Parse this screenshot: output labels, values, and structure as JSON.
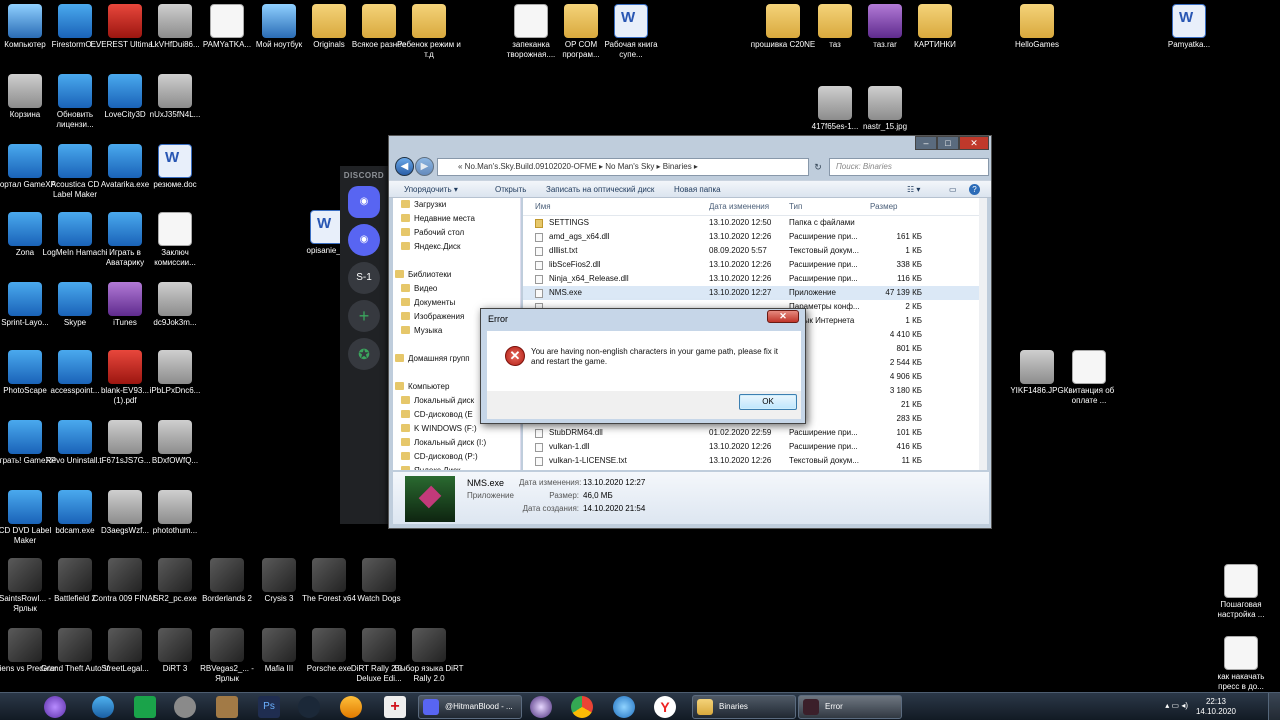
{
  "desktop": {
    "icons": [
      {
        "label": "Компьютер",
        "icon": "computer-icon"
      },
      {
        "label": "FirestormO...",
        "icon": "app-icon"
      },
      {
        "label": "EVEREST Ultima...",
        "icon": "info-icon"
      },
      {
        "label": "LkVHfDui86...",
        "icon": "image-icon"
      },
      {
        "label": "PAMYaTKA...",
        "icon": "document-icon"
      },
      {
        "label": "Мой ноутбук",
        "icon": "computer-icon"
      },
      {
        "label": "Originals",
        "icon": "folder-icon"
      },
      {
        "label": "Всякое разное",
        "icon": "folder-icon"
      },
      {
        "label": "Ребенок режим и т.д",
        "icon": "folder-icon"
      },
      {
        "label": "запеканка творожная....",
        "icon": "document-icon"
      },
      {
        "label": "OP COM програм...",
        "icon": "folder-icon"
      },
      {
        "label": "Рабочая книга супе...",
        "icon": "word-icon"
      },
      {
        "label": "прошивка C20NE",
        "icon": "folder-icon"
      },
      {
        "label": "таз",
        "icon": "folder-icon"
      },
      {
        "label": "таз.rar",
        "icon": "archive-icon"
      },
      {
        "label": "КАРТИНКИ",
        "icon": "folder-icon"
      },
      {
        "label": "HelloGames",
        "icon": "folder-icon"
      },
      {
        "label": "Pamyatka...",
        "icon": "word-icon"
      },
      {
        "label": "Корзина",
        "icon": "recycle-bin-icon"
      },
      {
        "label": "Обновить лицензи...",
        "icon": "app-icon"
      },
      {
        "label": "LoveCity3D",
        "icon": "app-icon"
      },
      {
        "label": "nUxJ35fN4L...",
        "icon": "image-icon"
      },
      {
        "label": "417f65es-1...",
        "icon": "image-icon"
      },
      {
        "label": "nastr_15.jpg",
        "icon": "image-icon"
      },
      {
        "label": "Портал GameXP",
        "icon": "app-icon"
      },
      {
        "label": "Acoustica CD Label Maker",
        "icon": "app-icon"
      },
      {
        "label": "Avatarika.exe",
        "icon": "app-icon"
      },
      {
        "label": "резюме.doc",
        "icon": "word-icon"
      },
      {
        "label": "opisanie_...",
        "icon": "word-icon"
      },
      {
        "label": "Zona",
        "icon": "app-icon"
      },
      {
        "label": "LogMeIn Hamachi",
        "icon": "app-icon"
      },
      {
        "label": "Играть в Аватарику",
        "icon": "app-icon"
      },
      {
        "label": "Заключ комиссии...",
        "icon": "document-icon"
      },
      {
        "label": "Sprint-Layo...",
        "icon": "app-icon"
      },
      {
        "label": "Skype",
        "icon": "skype-icon"
      },
      {
        "label": "iTunes",
        "icon": "itunes-icon"
      },
      {
        "label": "dc9Jok3m...",
        "icon": "image-icon"
      },
      {
        "label": "PhotoScape",
        "icon": "app-icon"
      },
      {
        "label": "accesspoint...",
        "icon": "app-icon"
      },
      {
        "label": "blank-EV93... (1).pdf",
        "icon": "pdf-icon"
      },
      {
        "label": "iPbLPxDnc6...",
        "icon": "image-icon"
      },
      {
        "label": "YIKF1486.JPG",
        "icon": "image-icon"
      },
      {
        "label": "Квитанция об оплате ...",
        "icon": "document-icon"
      },
      {
        "label": "Играть! GameXP",
        "icon": "app-icon"
      },
      {
        "label": "Revo Uninstall...",
        "icon": "app-icon"
      },
      {
        "label": "tF671sJS7G...",
        "icon": "image-icon"
      },
      {
        "label": "BDxfOWfQ...",
        "icon": "image-icon"
      },
      {
        "label": "CD DVD Label Maker",
        "icon": "app-icon"
      },
      {
        "label": "bdcam.exe",
        "icon": "app-icon"
      },
      {
        "label": "D3aegsWzf...",
        "icon": "image-icon"
      },
      {
        "label": "photothum...",
        "icon": "image-icon"
      },
      {
        "label": "SaintsRowI... - Ярлык",
        "icon": "game-icon"
      },
      {
        "label": "Battlefield 2",
        "icon": "game-icon"
      },
      {
        "label": "Contra 009 FINAL",
        "icon": "game-icon"
      },
      {
        "label": "SR2_pc.exe",
        "icon": "game-icon"
      },
      {
        "label": "Borderlands 2",
        "icon": "game-icon"
      },
      {
        "label": "Crysis 3",
        "icon": "game-icon"
      },
      {
        "label": "The Forest x64",
        "icon": "game-icon"
      },
      {
        "label": "Watch Dogs",
        "icon": "game-icon"
      },
      {
        "label": "Пошаговая настройка ...",
        "icon": "document-icon"
      },
      {
        "label": "Aliens vs Predator",
        "icon": "game-icon"
      },
      {
        "label": "Grand Theft Auto V",
        "icon": "game-icon"
      },
      {
        "label": "StreetLegal...",
        "icon": "game-icon"
      },
      {
        "label": "DiRT 3",
        "icon": "game-icon"
      },
      {
        "label": "RBVegas2_... - Ярлык",
        "icon": "game-icon"
      },
      {
        "label": "Mafia III",
        "icon": "game-icon"
      },
      {
        "label": "Porsche.exe",
        "icon": "game-icon"
      },
      {
        "label": "DiRT Rally 2.0 - Deluxe Edi...",
        "icon": "game-icon"
      },
      {
        "label": "Выбор языка DiRT Rally 2.0",
        "icon": "game-icon"
      },
      {
        "label": "как накачать пресс в до...",
        "icon": "document-icon"
      }
    ]
  },
  "discord": {
    "title": "DISCORD",
    "servers": [
      {
        "label": "",
        "icon": "discord-logo-icon"
      },
      {
        "label": "",
        "icon": "discord-logo-icon"
      },
      {
        "label": "S-1",
        "icon": ""
      },
      {
        "label": "+",
        "icon": "add-server-icon"
      },
      {
        "label": "",
        "icon": "explore-icon"
      }
    ]
  },
  "explorer": {
    "address": "« No.Man's.Sky.Build.09102020-OFME  ▸  No Man's Sky  ▸  Binaries  ▸",
    "search_placeholder": "Поиск: Binaries",
    "commands": [
      "Упорядочить ▾",
      "Открыть",
      "Записать на оптический диск",
      "Новая папка"
    ],
    "nav_items": [
      "Загрузки",
      "Недавние места",
      "Рабочий стол",
      "Яндекс.Диск",
      "",
      "Библиотеки",
      "Видео",
      "Документы",
      "Изображения",
      "Музыка",
      "",
      "Домашняя групп",
      "",
      "Компьютер",
      "Локальный диск",
      "CD-дисковод (E",
      "K WINDOWS (F:)",
      "Локальный диск (I:)",
      "CD-дисковод (P:)",
      "Яндекс.Диск"
    ],
    "columns": {
      "name": "Имя",
      "date": "Дата изменения",
      "type": "Тип",
      "size": "Размер"
    },
    "files": [
      {
        "name": "SETTINGS",
        "date": "13.10.2020 12:50",
        "type": "Папка с файлами",
        "size": "",
        "folder": true
      },
      {
        "name": "amd_ags_x64.dll",
        "date": "13.10.2020 12:26",
        "type": "Расширение при...",
        "size": "161 КБ"
      },
      {
        "name": "dlllist.txt",
        "date": "08.09.2020 5:57",
        "type": "Текстовый докум...",
        "size": "1 КБ"
      },
      {
        "name": "libSceFios2.dll",
        "date": "13.10.2020 12:26",
        "type": "Расширение при...",
        "size": "338 КБ"
      },
      {
        "name": "Ninja_x64_Release.dll",
        "date": "13.10.2020 12:26",
        "type": "Расширение при...",
        "size": "116 КБ"
      },
      {
        "name": "NMS.exe",
        "date": "13.10.2020 12:27",
        "type": "Приложение",
        "size": "47 139 КБ",
        "selected": true
      },
      {
        "name": "",
        "date": "",
        "type": "Параметры конф...",
        "size": "2 КБ"
      },
      {
        "name": "",
        "date": "",
        "type": "Ярлык Интернета",
        "size": "1 КБ"
      },
      {
        "name": "",
        "date": "",
        "type": "",
        "size": "4 410 КБ"
      },
      {
        "name": "",
        "date": "",
        "type": "",
        "size": "801 КБ"
      },
      {
        "name": "",
        "date": "",
        "type": "",
        "size": "2 544 КБ"
      },
      {
        "name": "",
        "date": "",
        "type": "",
        "size": "4 906 КБ"
      },
      {
        "name": "",
        "date": "",
        "type": "",
        "size": "3 180 КБ"
      },
      {
        "name": "",
        "date": "",
        "type": "",
        "size": "21 КБ"
      },
      {
        "name": "",
        "date": "",
        "type": "",
        "size": "283 КБ"
      },
      {
        "name": "StubDRM64.dll",
        "date": "01.02.2020 22:59",
        "type": "Расширение при...",
        "size": "101 КБ"
      },
      {
        "name": "vulkan-1.dll",
        "date": "13.10.2020 12:26",
        "type": "Расширение при...",
        "size": "416 КБ"
      },
      {
        "name": "vulkan-1-LICENSE.txt",
        "date": "13.10.2020 12:26",
        "type": "Текстовый докум...",
        "size": "11 КБ"
      }
    ],
    "details": {
      "name": "NMS.exe",
      "kind": "Приложение",
      "modified_label": "Дата изменения:",
      "modified": "13.10.2020 12:27",
      "size_label": "Размер:",
      "size": "46,0 МБ",
      "created_label": "Дата создания:",
      "created": "14.10.2020 21:54"
    }
  },
  "dialog": {
    "title": "Error",
    "message": "You are having non-english characters in your game path, please fix it and restart the game.",
    "ok": "OK"
  },
  "taskbar": {
    "windows": [
      {
        "label": "@HitmanBlood - ...",
        "icon": "discord-icon"
      },
      {
        "label": "Binaries",
        "icon": "folder-icon"
      },
      {
        "label": "Error",
        "icon": "nms-icon"
      }
    ],
    "time": "22:13",
    "date": "14.10.2020"
  }
}
